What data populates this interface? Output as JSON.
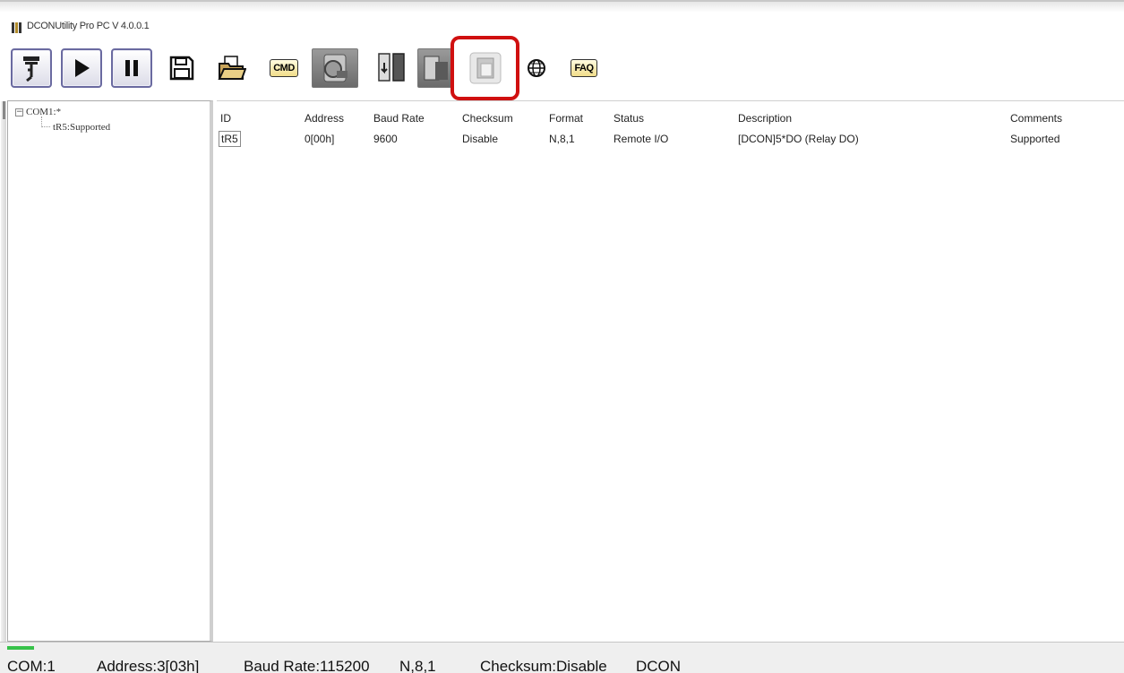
{
  "window": {
    "title": "DCONUtility Pro PC V 4.0.0.1"
  },
  "toolbar": {
    "buttons": [
      {
        "name": "search",
        "icon": "search-device-icon"
      },
      {
        "name": "play",
        "icon": "play-icon"
      },
      {
        "name": "pause",
        "icon": "pause-icon"
      },
      {
        "name": "save",
        "icon": "save-icon"
      },
      {
        "name": "open",
        "icon": "open-folder-icon"
      },
      {
        "name": "cmd",
        "label": "CMD"
      },
      {
        "name": "module-config",
        "icon": "module-config-icon"
      },
      {
        "name": "firmware",
        "icon": "firmware-icon"
      },
      {
        "name": "device-info",
        "icon": "device-info-icon"
      },
      {
        "name": "highlighted-tool",
        "icon": "document-icon",
        "highlighted": true
      },
      {
        "name": "web",
        "icon": "globe-icon"
      },
      {
        "name": "faq",
        "label": "FAQ"
      }
    ],
    "highlight_color": "#d01010"
  },
  "tree": {
    "root": "COM1:*",
    "expander": "−",
    "child": "tR5:Supported"
  },
  "list": {
    "columns": [
      "ID",
      "Address",
      "Baud Rate",
      "Checksum",
      "Format",
      "Status",
      "Description",
      "Comments"
    ],
    "rows": [
      {
        "id": "tR5",
        "address": "0[00h]",
        "baud_rate": "9600",
        "checksum": "Disable",
        "format": "N,8,1",
        "status": "Remote I/O",
        "description": "[DCON]5*DO (Relay DO)",
        "comments": "Supported"
      }
    ]
  },
  "statusbar": {
    "com": "COM:1",
    "address": "Address:3[03h]",
    "baud_rate": "Baud Rate:115200",
    "format": "N,8,1",
    "checksum": "Checksum:Disable",
    "protocol": "DCON",
    "progress_color": "#37c24a"
  }
}
